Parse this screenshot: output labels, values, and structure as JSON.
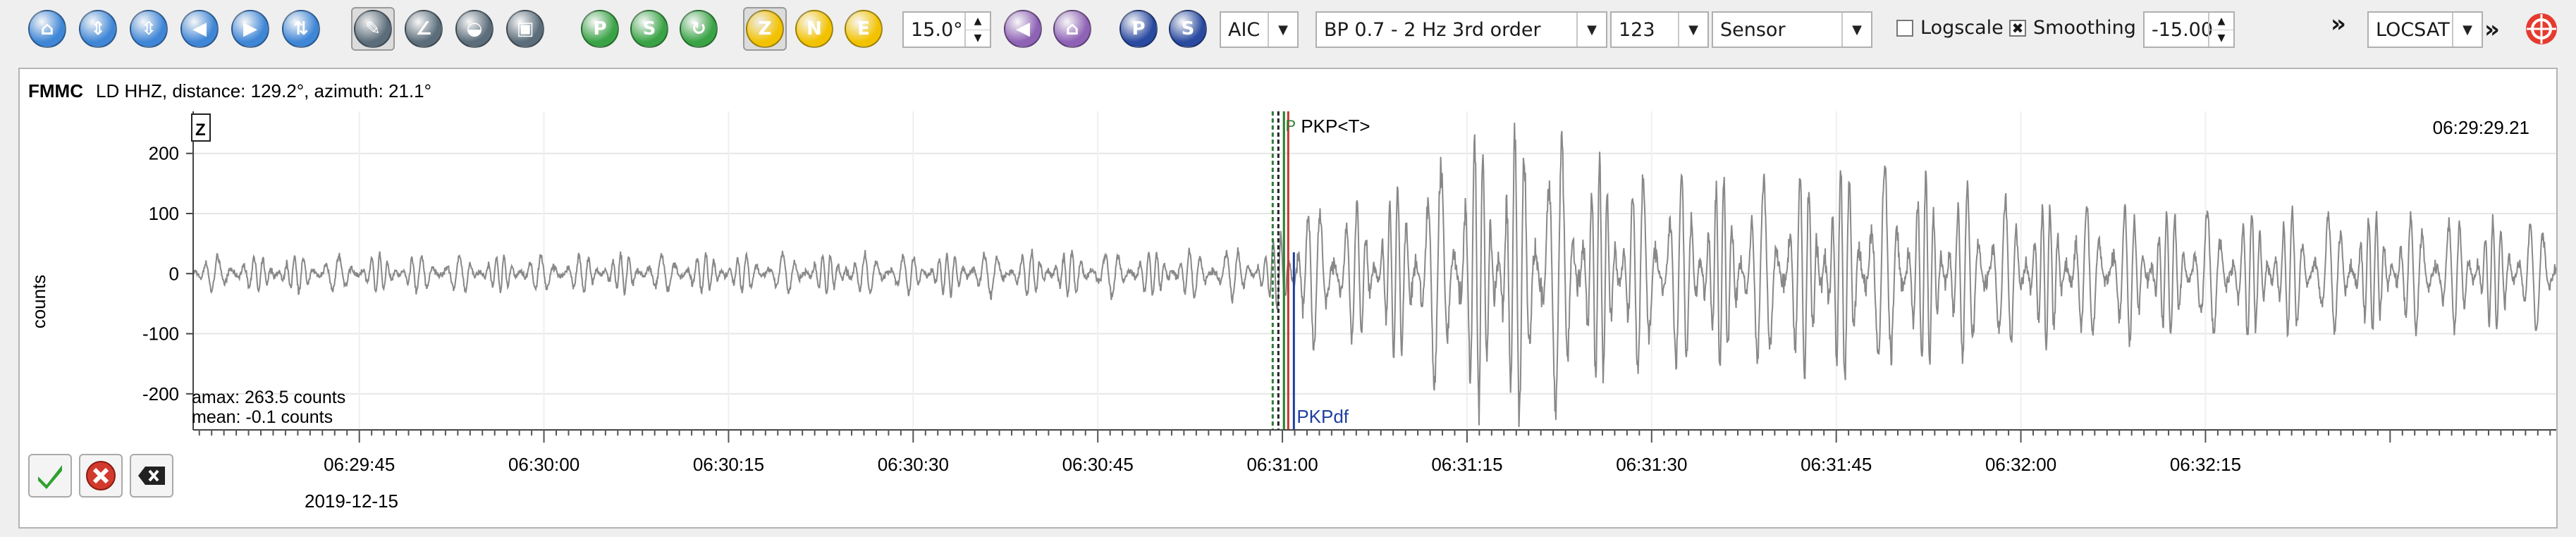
{
  "toolbar": {
    "nav_buttons": [
      {
        "name": "home-icon",
        "color": "#3f86d6",
        "glyph": "⌂"
      },
      {
        "name": "zoom-in-icon",
        "color": "#3f86d6",
        "glyph": "⇕"
      },
      {
        "name": "zoom-out-icon",
        "color": "#3f86d6",
        "glyph": "⇳"
      },
      {
        "name": "scroll-left-icon",
        "color": "#3f86d6",
        "glyph": "◀"
      },
      {
        "name": "scroll-right-icon",
        "color": "#3f86d6",
        "glyph": "▶"
      },
      {
        "name": "expand-vertical-icon",
        "color": "#3f86d6",
        "glyph": "⇅"
      }
    ],
    "tool_buttons": [
      {
        "name": "pick-tool-icon",
        "color": "#5b6d7a",
        "glyph": "✎",
        "pressed": true
      },
      {
        "name": "measure-angle-icon",
        "color": "#5b6d7a",
        "glyph": "∠"
      },
      {
        "name": "spectrum-icon",
        "color": "#5b6d7a",
        "glyph": "◒"
      },
      {
        "name": "save-icon",
        "color": "#5b6d7a",
        "glyph": "▣"
      }
    ],
    "pick_buttons": [
      {
        "name": "pick-p-icon",
        "color": "#3aa346",
        "glyph": "P"
      },
      {
        "name": "pick-s-icon",
        "color": "#3aa346",
        "glyph": "S"
      },
      {
        "name": "refresh-icon",
        "color": "#3aa346",
        "glyph": "↻"
      }
    ],
    "component_buttons": [
      {
        "name": "component-z-icon",
        "label": "Z",
        "pressed": true
      },
      {
        "name": "component-n-icon",
        "label": "N"
      },
      {
        "name": "component-e-icon",
        "label": "E"
      }
    ],
    "rotation_value": "15.0°",
    "extra_buttons": [
      {
        "name": "phase-marker-icon",
        "color": "#8e62b5",
        "glyph": "◀"
      },
      {
        "name": "theoretical-icon",
        "color": "#8e62b5",
        "glyph": "⌂"
      }
    ],
    "phase_buttons": [
      {
        "name": "phase-p-icon",
        "label": "P",
        "color": "#2a4aa0"
      },
      {
        "name": "phase-s-icon",
        "label": "S",
        "color": "#2a4aa0"
      }
    ],
    "picker_method": "AIC",
    "filter": "BP 0.7 - 2 Hz  3rd order",
    "filter_order": "123",
    "unit_mode": "Sensor",
    "logscale_label": "Logscale",
    "logscale_checked": false,
    "smoothing_label": "Smoothing",
    "smoothing_checked": true,
    "amplitude_value": "-15.00",
    "overflow_chevron": "»",
    "locator": "LOCSAT",
    "locator_chevron": "»"
  },
  "trace": {
    "station": "FMMC",
    "info": "LD  HHZ, distance: 129.2°, azimuth: 21.1°",
    "component_badge": "Z",
    "end_time": "06:29:29.21",
    "amax": "amax: 263.5 counts",
    "mean": "mean: -0.1 counts",
    "pick_top": "PKP<T>",
    "pick_top_marker": "P",
    "pick_bottom": "PKPdf",
    "date": "2019-12-15"
  },
  "chart_data": {
    "type": "line",
    "ylabel": "counts",
    "xlabel": "",
    "ylim": [
      -260,
      270
    ],
    "y_ticks": [
      200,
      100,
      0,
      -100,
      -200
    ],
    "x_range_seconds": [
      -103.5,
      88.5
    ],
    "x_ticks": [
      {
        "offset": -90,
        "label": "06:29:45"
      },
      {
        "offset": -75,
        "label": "06:30:00"
      },
      {
        "offset": -60,
        "label": "06:30:15"
      },
      {
        "offset": -45,
        "label": "06:30:30"
      },
      {
        "offset": -30,
        "label": "06:30:45"
      },
      {
        "offset": -15,
        "label": "06:31:00"
      },
      {
        "offset": 0,
        "label": "06:31:15"
      },
      {
        "offset": 15,
        "label": "06:31:30"
      },
      {
        "offset": 30,
        "label": "06:31:45"
      },
      {
        "offset": 45,
        "label": "06:32:00"
      },
      {
        "offset": 60,
        "label": "06:32:15"
      }
    ],
    "pick_time_offset": -15.1,
    "envelope": [
      {
        "t": -103.5,
        "amp": 30
      },
      {
        "t": -60,
        "amp": 32
      },
      {
        "t": -30,
        "amp": 38
      },
      {
        "t": -16,
        "amp": 42
      },
      {
        "t": -14,
        "amp": 130
      },
      {
        "t": -10,
        "amp": 110
      },
      {
        "t": -5,
        "amp": 150
      },
      {
        "t": 0,
        "amp": 230
      },
      {
        "t": 6,
        "amp": 250
      },
      {
        "t": 12,
        "amp": 170
      },
      {
        "t": 25,
        "amp": 160
      },
      {
        "t": 32,
        "amp": 190
      },
      {
        "t": 45,
        "amp": 120
      },
      {
        "t": 70,
        "amp": 100
      },
      {
        "t": 88.5,
        "amp": 90
      }
    ],
    "trace_color": "#888888",
    "pick_colors": {
      "manual": "#2e7d32",
      "theoretical": "#222222",
      "automatic": "#c0392b",
      "blue": "#1f3fa0"
    },
    "grid": true
  }
}
